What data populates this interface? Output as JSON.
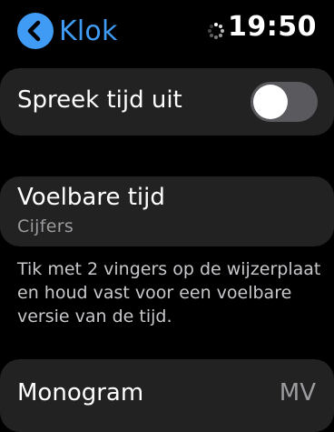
{
  "nav": {
    "back_label": "Klok",
    "time": "19:50"
  },
  "speak_time": {
    "label": "Spreek tijd uit",
    "enabled": false
  },
  "tactile_time": {
    "label": "Voelbare tijd",
    "value": "Cijfers",
    "footnote": "Tik met 2 vingers op de wijzerplaat en houd vast voor een voelbare versie van de tijd."
  },
  "monogram": {
    "label": "Monogram",
    "value": "MV"
  },
  "colors": {
    "accent": "#3f9bf4",
    "card": "#222222",
    "secondary_text": "#9c9ca0"
  }
}
